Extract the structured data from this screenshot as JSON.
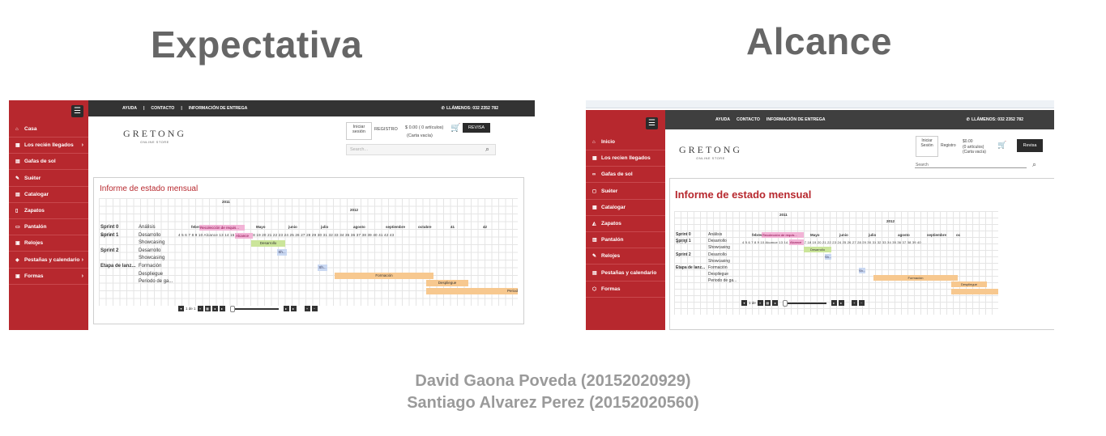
{
  "page": {
    "title_left": "Expectativa",
    "title_right": "Alcance",
    "author_line1": "David Gaona  Poveda (20152020929)",
    "author_line2": "Santiago Alvarez Perez (20152020560)"
  },
  "colors": {
    "brand_red": "#b7282e",
    "dark": "#333333",
    "gray_text": "#666666"
  },
  "left": {
    "menu_icon": "hamburger-icon",
    "sidebar": [
      {
        "label": "Casa",
        "icon": "home-icon"
      },
      {
        "label": "Los recién llegados",
        "icon": "grid-icon",
        "chevron": true
      },
      {
        "label": "Gafas de sol",
        "icon": "document-icon"
      },
      {
        "label": "Suéter",
        "icon": "pencil-icon"
      },
      {
        "label": "Catalogar",
        "icon": "document-icon"
      },
      {
        "label": "Zapatos",
        "icon": "tablet-icon"
      },
      {
        "label": "Pantalón",
        "icon": "card-icon"
      },
      {
        "label": "Relojes",
        "icon": "image-icon"
      },
      {
        "label": "Pestañas y calendario",
        "icon": "layers-icon",
        "chevron": true
      },
      {
        "label": "Formas",
        "icon": "image-icon",
        "chevron": true
      }
    ],
    "topbar": {
      "link1": "AYUDA",
      "sep1": "|",
      "link2": "CONTACTO",
      "sep2": "|",
      "link3": "INFORMACIÓN DE ENTREGA",
      "phone": "LLÁMENOS: 032 2352 782"
    },
    "logo": {
      "name": "GRETONG",
      "sub": "ONLINE STORE"
    },
    "login": "Iniciar sesión",
    "register": "REGISTRO",
    "cart": "$ 0.00 ( 0 artículos)",
    "cart_empty": "(Carta vacía)",
    "revisa": "REVISA",
    "search_placeholder": "Search...",
    "report_title": "Informe de estado mensual",
    "gantt": {
      "year1": "2011",
      "year2": "2012",
      "months": [
        "febrer",
        "abril",
        "Mayo",
        "junio",
        "julio",
        "agosto",
        "septiembre",
        "octubre",
        "41",
        "42"
      ],
      "days": "4  5  6  7  8  9  10  Alcance  13  14  15  dieci  17  18  19  20  21  22  23  24  25  26  27  28  29  30  31  32  33  34  35  36  37  38  39  40  41  42  43",
      "rows": [
        {
          "group": "Sprint 0",
          "task": "Análisis"
        },
        {
          "group": "Sprint 1",
          "task": "Desarrollo"
        },
        {
          "group": "",
          "task": "Showcasing"
        },
        {
          "group": "Sprint 2",
          "task": "Desarrollo"
        },
        {
          "group": "",
          "task": "Showcasing"
        },
        {
          "group": "Etapa de lanz...",
          "task": "Formación"
        },
        {
          "group": "",
          "task": "Despliegue"
        },
        {
          "group": "",
          "task": "Periodo de ga..."
        }
      ],
      "bars": {
        "recoleccion": "Recolección de requis...",
        "alcance": "Alcance",
        "desarrollo": "Desarrollo",
        "sh": "Sh...",
        "sh2": "Sh...",
        "formacion": "Formación",
        "despliegue": "Despliegue",
        "periodo": "Period"
      },
      "pager_text": "1 de 1"
    }
  },
  "right": {
    "menu_icon": "hamburger-icon",
    "sidebar": [
      {
        "label": "Inicio",
        "icon": "home-icon"
      },
      {
        "label": "Los recien llegados",
        "icon": "grid-icon"
      },
      {
        "label": "Gafas de sol",
        "icon": "sunglasses-icon"
      },
      {
        "label": "Suéter",
        "icon": "shirt-icon"
      },
      {
        "label": "Catalogar",
        "icon": "grid-icon"
      },
      {
        "label": "Zapatos",
        "icon": "shoe-icon"
      },
      {
        "label": "Pantalón",
        "icon": "pants-icon"
      },
      {
        "label": "Relojes",
        "icon": "pencil-icon"
      },
      {
        "label": "Pestañas y calendario",
        "icon": "calendar-icon"
      },
      {
        "label": "Formas",
        "icon": "shape-icon"
      }
    ],
    "topbar": {
      "link1": "AYUDA",
      "link2": "CONTACTO",
      "link3": "INFORMACIÓN DE ENTREGA",
      "phone": "LLÁMENOS: 032 2352 782"
    },
    "logo": {
      "name": "GRETONG",
      "sub": "ONLINE STORE"
    },
    "login": "Iniciar Sesión",
    "register": "Registro",
    "cart": "$0.00",
    "cart_items": "(0 artículos)",
    "cart_empty": "(Carta vacía)",
    "revisa": "Revisa",
    "search_placeholder": "Search",
    "report_title": "Informe de estado mensual",
    "gantt": {
      "year1": "2011",
      "year2": "2012",
      "months": [
        "febrer",
        "abril",
        "Mayo",
        "junio",
        "julio",
        "agosto",
        "septiembre",
        "oc"
      ],
      "days": "4  5  6  7  8  9  10  Alcance  13  14  15  dieci  17  18  19  20  21  22  23  24  25  26  27  28  29  30  31  32  33  34  35  36  37  38  39  40",
      "rows": [
        {
          "group": "Sprint 0",
          "task": "Análisis"
        },
        {
          "group": "Sprint 1",
          "task": "Desarrollo"
        },
        {
          "group": "",
          "task": "Showcasing"
        },
        {
          "group": "Sprint 2",
          "task": "Desarrollo"
        },
        {
          "group": "",
          "task": "Showcasing"
        },
        {
          "group": "Etapa de lanz...",
          "task": "Formación"
        },
        {
          "group": "",
          "task": "Despliegue"
        },
        {
          "group": "",
          "task": "Periodo de ga..."
        }
      ],
      "bars": {
        "recoleccion": "Recolección de requis...",
        "alcance": "Alcance",
        "desarrollo": "Desarrollo",
        "sh": "Sh...",
        "sh2": "Sh...",
        "formacion": "Formación",
        "despliegue": "Despliegue"
      },
      "pager_text": "1 de"
    }
  }
}
